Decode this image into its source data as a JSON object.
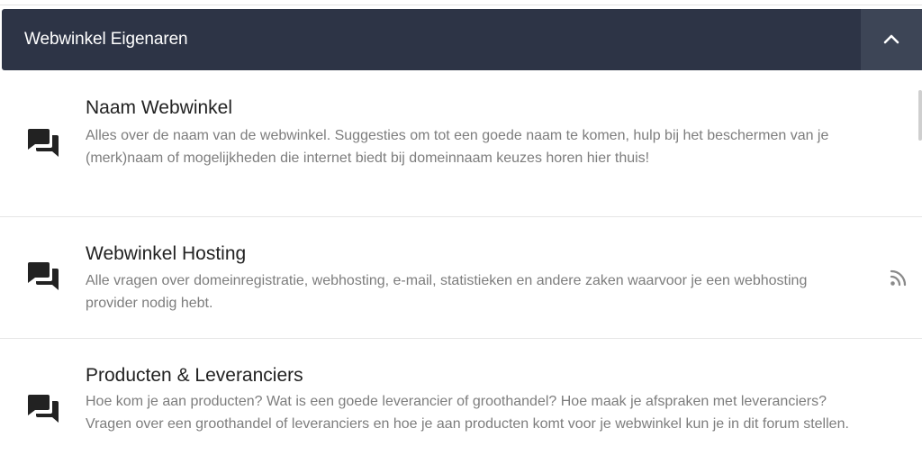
{
  "category": {
    "title": "Webwinkel Eigenaren",
    "collapse_icon": "chevron-up-icon"
  },
  "forums": [
    {
      "icon": "forum-chat-icon",
      "title": "Naam Webwinkel",
      "description": "Alles over de naam van de webwinkel. Suggesties om tot een goede naam te komen, hulp bij het beschermen van je (merk)naam of mogelijkheden die internet biedt bij domeinnaam keuzes horen hier thuis!"
    },
    {
      "icon": "forum-chat-icon",
      "title": "Webwinkel Hosting",
      "description": "Alle vragen over domeinregistratie, webhosting, e-mail, statistieken en andere zaken waarvoor je een webhosting provider nodig hebt.",
      "rss_icon": "rss-icon"
    },
    {
      "icon": "forum-chat-icon",
      "title": "Producten & Leveranciers",
      "description": "Hoe kom je aan producten? Wat is een goede leverancier of groothandel? Hoe maak je afspraken met leveranciers? Vragen over een groothandel of leveranciers en hoe je aan producten komt voor je webwinkel kun je in dit forum stellen."
    }
  ],
  "colors": {
    "header_bg": "#2d3446",
    "header_button_bg": "#3d4556",
    "title_text": "#222222",
    "description_text": "#7d7d7d"
  }
}
